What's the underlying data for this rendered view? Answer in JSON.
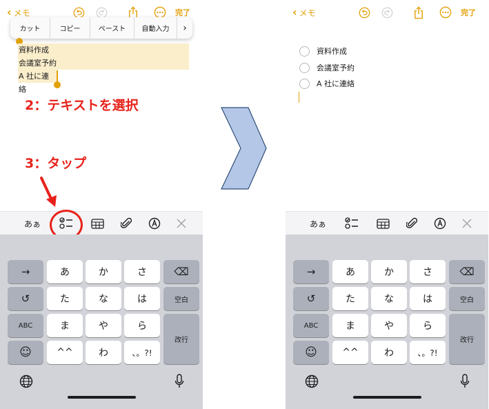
{
  "notes_header": {
    "back_label": "メモ",
    "done_label": "完了",
    "accent_color": "#e3a008"
  },
  "context_menu": {
    "items": [
      "カット",
      "コピー",
      "ペースト",
      "自動入力",
      "›"
    ]
  },
  "selected_lines": [
    "資料作成",
    "会議室予約",
    "A 社に連絡"
  ],
  "checklist": [
    "資料作成",
    "会議室予約",
    "A 社に連絡"
  ],
  "annotations": {
    "step2": "2：テキストを選択",
    "step3": "3：タップ",
    "color": "#e8221b"
  },
  "toolbar": {
    "format_label": "あぁ",
    "icons": [
      "checklist-icon",
      "table-icon",
      "paperclip-icon",
      "markup-icon",
      "close-icon"
    ]
  },
  "keyboard": {
    "row1": [
      "→",
      "あ",
      "か",
      "さ",
      "⌫"
    ],
    "row2": [
      "↺",
      "た",
      "な",
      "は",
      "空白"
    ],
    "row3": [
      "ABC",
      "ま",
      "や",
      "ら",
      "改行"
    ],
    "row4": [
      "☺",
      "^^",
      "わ",
      "、。?!"
    ]
  },
  "transition_arrow_color": "#b4c7e7"
}
